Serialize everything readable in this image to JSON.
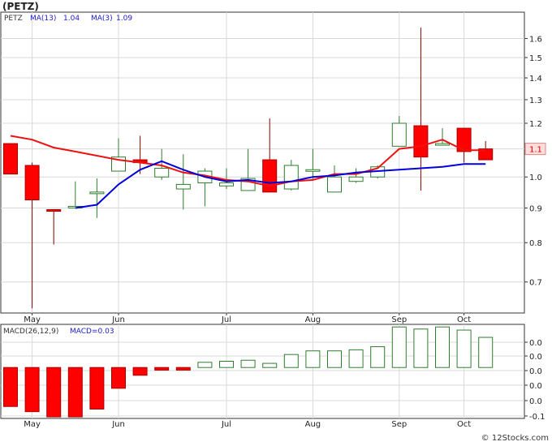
{
  "header": {
    "symbol": "(PETZ)",
    "legend": [
      {
        "text": "PETZ",
        "color": "#333333"
      },
      {
        "text": "MA(13)",
        "color": "#1a1acc"
      },
      {
        "text": "1.04",
        "color": "#1a1acc"
      },
      {
        "text": "MA(3)",
        "color": "#1a1acc"
      },
      {
        "text": "1.09",
        "color": "#1a1acc"
      }
    ]
  },
  "macd_header": [
    {
      "text": "MACD(26,12,9)",
      "color": "#333333"
    },
    {
      "text": "MACD=0.03",
      "color": "#1a1acc"
    }
  ],
  "footer": {
    "copyright": "© 12Stocks.com"
  },
  "colors": {
    "up": "#2e7d2e",
    "down": "#ff0000",
    "ma_long": "#0000dd",
    "ma_short": "#ee1111",
    "grid": "#d8d8d8",
    "axis": "#333333",
    "panel_bg": "#ffffff"
  },
  "chart_data": [
    {
      "type": "candlestick",
      "scale": "log",
      "ylim": [
        0.63,
        1.75
      ],
      "y_ticks": [
        "1.6",
        "1.5",
        "1.4",
        "1.3",
        "1.2",
        "1.1",
        "1.0",
        "0.9",
        "0.8",
        "0.7"
      ],
      "x_ticks": [
        "May",
        "Jun",
        "Jul",
        "Aug",
        "Sep",
        "Oct"
      ],
      "last_price_label": "1.1",
      "candles": [
        {
          "o": 1.12,
          "h": 1.12,
          "l": 1.01,
          "c": 1.01
        },
        {
          "o": 1.04,
          "h": 1.05,
          "l": 0.64,
          "c": 0.925
        },
        {
          "o": 0.895,
          "h": 0.895,
          "l": 0.795,
          "c": 0.89
        },
        {
          "o": 0.905,
          "h": 0.985,
          "l": 0.9,
          "c": 0.905
        },
        {
          "o": 0.95,
          "h": 0.995,
          "l": 0.87,
          "c": 0.95
        },
        {
          "o": 1.02,
          "h": 1.14,
          "l": 1.02,
          "c": 1.07
        },
        {
          "o": 1.06,
          "h": 1.15,
          "l": 1.01,
          "c": 1.05
        },
        {
          "o": 1.0,
          "h": 1.1,
          "l": 0.99,
          "c": 1.03
        },
        {
          "o": 0.96,
          "h": 1.08,
          "l": 0.895,
          "c": 0.975
        },
        {
          "o": 0.98,
          "h": 1.03,
          "l": 0.905,
          "c": 1.02
        },
        {
          "o": 0.97,
          "h": 1.03,
          "l": 0.96,
          "c": 0.98
        },
        {
          "o": 0.955,
          "h": 1.1,
          "l": 0.955,
          "c": 0.995
        },
        {
          "o": 1.06,
          "h": 1.22,
          "l": 0.95,
          "c": 0.95
        },
        {
          "o": 0.96,
          "h": 1.06,
          "l": 0.955,
          "c": 1.04
        },
        {
          "o": 1.02,
          "h": 1.1,
          "l": 0.99,
          "c": 1.025
        },
        {
          "o": 0.95,
          "h": 1.04,
          "l": 0.95,
          "c": 1.0
        },
        {
          "o": 0.985,
          "h": 1.03,
          "l": 0.98,
          "c": 1.0
        },
        {
          "o": 1.0,
          "h": 1.04,
          "l": 0.995,
          "c": 1.035
        },
        {
          "o": 1.11,
          "h": 1.23,
          "l": 1.11,
          "c": 1.2
        },
        {
          "o": 1.19,
          "h": 1.66,
          "l": 0.955,
          "c": 1.07
        },
        {
          "o": 1.12,
          "h": 1.18,
          "l": 1.12,
          "c": 1.12
        },
        {
          "o": 1.18,
          "h": 1.18,
          "l": 1.05,
          "c": 1.09
        },
        {
          "o": 1.1,
          "h": 1.13,
          "l": 1.06,
          "c": 1.06
        }
      ],
      "ma13": [
        null,
        null,
        null,
        0.9,
        0.91,
        0.975,
        1.025,
        1.055,
        1.025,
        1.0,
        0.985,
        0.99,
        0.98,
        0.985,
        1.0,
        1.005,
        1.015,
        1.02,
        1.025,
        1.03,
        1.035,
        1.045,
        1.045
      ],
      "ma3": [
        1.15,
        1.135,
        1.105,
        1.09,
        1.075,
        1.06,
        1.05,
        1.04,
        1.015,
        1.005,
        0.99,
        0.985,
        0.97,
        0.985,
        0.99,
        1.01,
        1.01,
        1.03,
        1.1,
        1.11,
        1.135,
        1.095,
        1.095
      ]
    },
    {
      "type": "bar",
      "name": "MACD histogram",
      "y_ticks": [
        "0.0",
        "0.0",
        "0.0",
        "0.0",
        "0.0",
        "0.0",
        "-0.1"
      ],
      "values": [
        -0.075,
        -0.085,
        -0.095,
        -0.095,
        -0.08,
        -0.04,
        -0.015,
        -0.005,
        -0.005,
        0.01,
        0.012,
        0.014,
        0.008,
        0.025,
        0.032,
        0.032,
        0.034,
        0.04,
        0.078,
        0.074,
        0.078,
        0.072,
        0.058
      ],
      "ylim": [
        -0.098,
        0.083
      ]
    }
  ]
}
